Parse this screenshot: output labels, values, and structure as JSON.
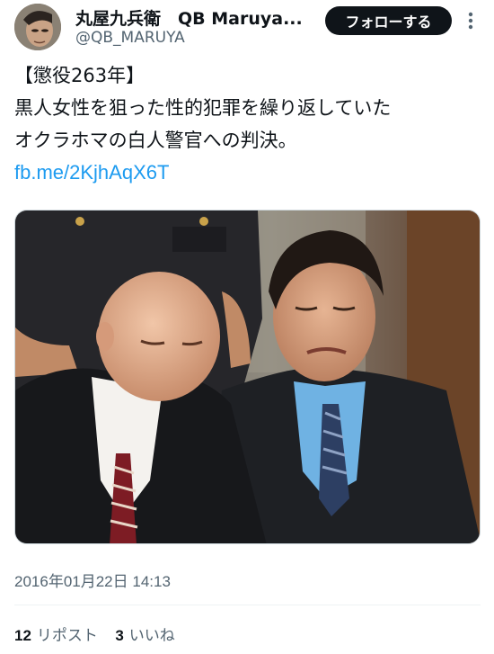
{
  "author": {
    "display_name": "丸屋九兵衛　QB Maruya...",
    "handle": "@QB_MARUYA"
  },
  "follow_button": "フォローする",
  "post": {
    "lines": [
      "【懲役263年】",
      "黒人女性を狙った性的犯罪を繰り返していた",
      "オクラホマの白人警官への判決。"
    ],
    "link": "fb.me/2KjhAqX6T",
    "timestamp": "2016年01月22日 14:13"
  },
  "stats": {
    "reposts_count": "12",
    "reposts_label": "リポスト",
    "likes_count": "3",
    "likes_label": "いいね"
  },
  "colors": {
    "accent_link": "#1d9bf0",
    "follow_bg": "#0f1419",
    "secondary_text": "#536471"
  },
  "icons": {
    "more": "more-vertical-icon"
  }
}
